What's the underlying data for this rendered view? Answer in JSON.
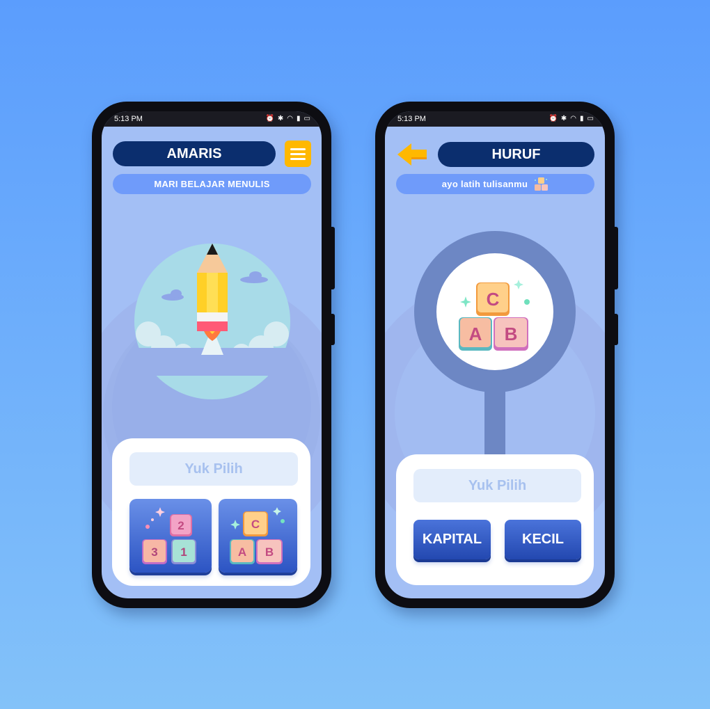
{
  "left_phone": {
    "status": {
      "time": "5:13 PM",
      "icons": [
        "alarm-icon",
        "bluetooth-icon",
        "wifi-icon",
        "signal-icon",
        "battery-icon"
      ]
    },
    "title": "AMARIS",
    "subtitle": "MARI BELAJAR MENULIS",
    "menu_icon": "hamburger-menu-icon",
    "illustration": "pencil-rocket-illustration",
    "panel": {
      "prompt": "Yuk Pilih",
      "options": [
        {
          "name": "numbers",
          "blocks": [
            "2",
            "3",
            "1"
          ]
        },
        {
          "name": "letters",
          "blocks": [
            "C",
            "A",
            "B"
          ]
        }
      ]
    }
  },
  "right_phone": {
    "status": {
      "time": "5:13 PM",
      "icons": [
        "alarm-icon",
        "bluetooth-icon",
        "wifi-icon",
        "signal-icon",
        "battery-icon"
      ]
    },
    "back_icon": "back-arrow-icon",
    "title": "HURUF",
    "subtitle": "ayo latih tulisanmu",
    "illustration": {
      "name": "alphabet-blocks-magnifier",
      "blocks": [
        "C",
        "A",
        "B"
      ]
    },
    "panel": {
      "prompt": "Yuk Pilih",
      "buttons": [
        "KAPITAL",
        "KECIL"
      ]
    }
  },
  "colors": {
    "background_top": "#5b9dfd",
    "background_bottom": "#83c2f9",
    "navy": "#0b2e6e",
    "accent_yellow": "#ffb800",
    "screen": "#a3bff5"
  }
}
